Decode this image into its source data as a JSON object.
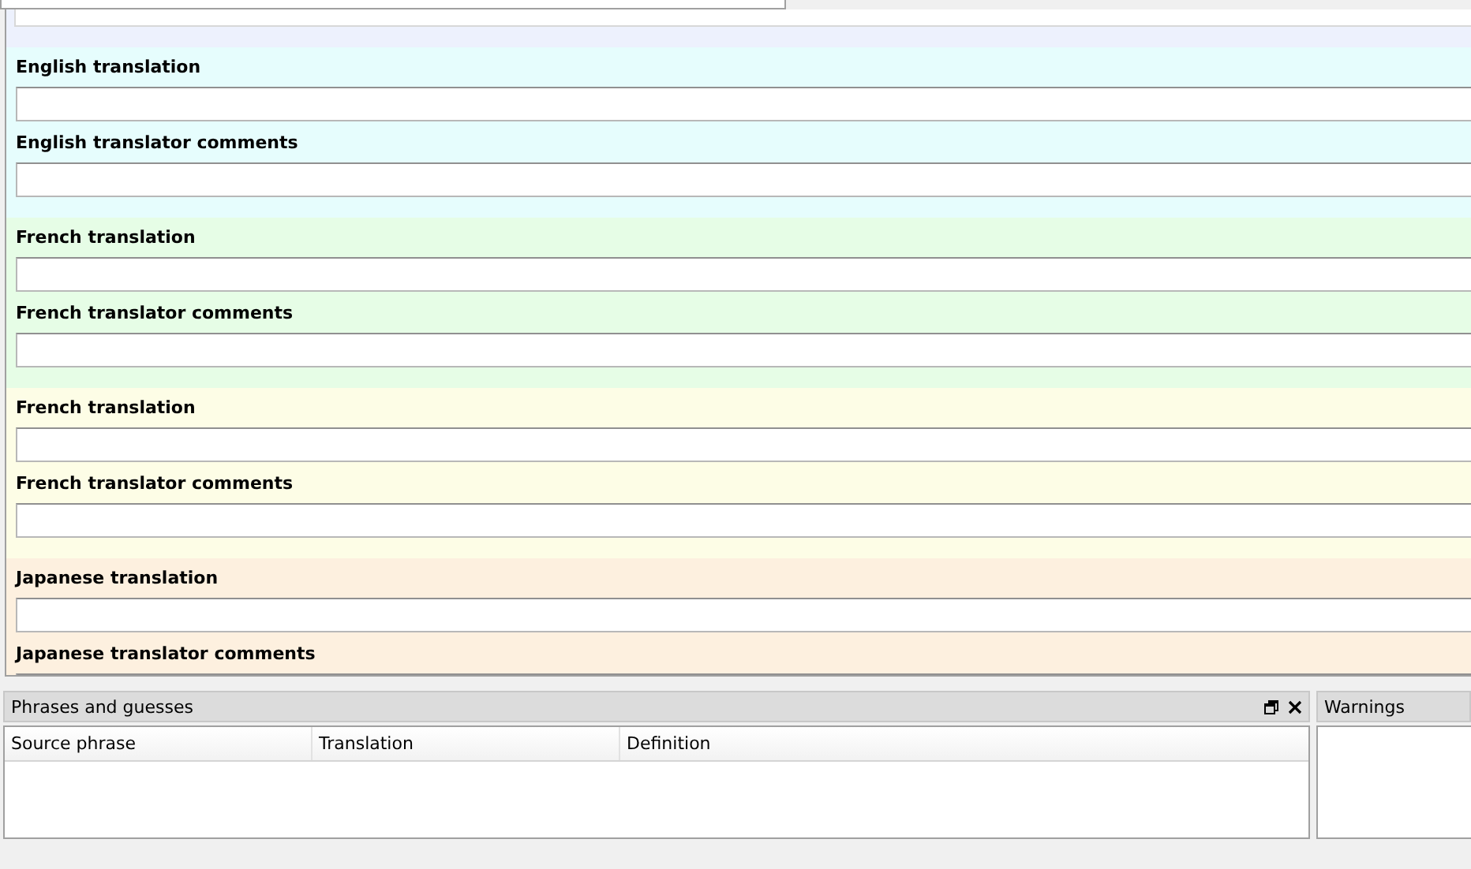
{
  "editor": {
    "sections": [
      {
        "kind": "partial",
        "color": "#edf1fd",
        "fields": [
          {
            "kind": "input"
          }
        ]
      },
      {
        "kind": "full",
        "color": "#e6fdfd",
        "fields": [
          {
            "kind": "input",
            "label": "English translation"
          },
          {
            "kind": "input",
            "label": "English translator comments"
          }
        ]
      },
      {
        "kind": "full",
        "color": "#e6fde6",
        "fields": [
          {
            "kind": "input",
            "label": "French translation"
          },
          {
            "kind": "input",
            "label": "French translator comments"
          }
        ]
      },
      {
        "kind": "full",
        "color": "#fdfde6",
        "fields": [
          {
            "kind": "input",
            "label": "French translation"
          },
          {
            "kind": "input",
            "label": "French translator comments"
          }
        ]
      },
      {
        "kind": "full",
        "color": "#fdf0df",
        "fields": [
          {
            "kind": "input",
            "label": "Japanese translation"
          },
          {
            "kind": "input",
            "label": "Japanese translator comments"
          }
        ]
      }
    ]
  },
  "phrases_panel": {
    "title": "Phrases and guesses",
    "columns": [
      "Source phrase",
      "Translation",
      "Definition"
    ]
  },
  "warnings_panel": {
    "title": "Warnings"
  }
}
